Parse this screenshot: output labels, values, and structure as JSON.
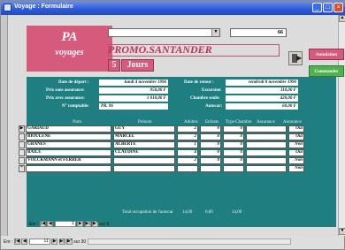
{
  "window": {
    "title": "Voyage : Formulaire"
  },
  "logo": {
    "line1": "PA",
    "line2": "voyages"
  },
  "header": {
    "combo_value": "",
    "trip_id": "66",
    "trip_name": "PROMO.SANTANDER",
    "duration_value": "5",
    "duration_unit": "Jours"
  },
  "buttons": {
    "annulation": "Annulation",
    "commander": "Commander"
  },
  "info": {
    "date_depart_label": "Date de départ :",
    "date_depart_value": "lundi 4 novembre 1996",
    "date_retour_label": "Date de retour :",
    "date_retour_value": "vendredi 8 novembre 1996",
    "prix_sans_label": "Prix sans assurance:",
    "prix_sans_value": "950,00 F",
    "excursion_label": "Excursion",
    "excursion_value": "110,00 F",
    "prix_avec_label": "Prix avec assurance:",
    "prix_avec_value": "1 010,00 F",
    "chambre_label": "Chambre seule:",
    "chambre_value": "420,00 F",
    "compta_label": "N° comptable:",
    "compta_value": "PR. 96",
    "autocar_label": "Autocar:",
    "autocar_value": "60,00 F"
  },
  "grid": {
    "headers": [
      "Nom",
      "Prénom",
      "Adultes",
      "Enfants",
      "Type Chambre",
      "Assurance",
      "Assurance"
    ],
    "rows": [
      {
        "nom": "GARIAUD",
        "prenom": "GUY",
        "adultes": "2",
        "enfants": "0",
        "chambre": "0",
        "assurance": "Oui"
      },
      {
        "nom": "BIOULENE",
        "prenom": "MARCEL",
        "adultes": "2",
        "enfants": "0",
        "chambre": "0",
        "assurance": "Oui"
      },
      {
        "nom": "GRANES",
        "prenom": "ALBERTE",
        "adultes": "1",
        "enfants": "0",
        "chambre": "0",
        "assurance": "Non"
      },
      {
        "nom": "BAILE",
        "prenom": "CLAUDINE",
        "adultes": "4",
        "enfants": "0",
        "chambre": "0",
        "assurance": "Oui"
      },
      {
        "nom": "VOLCKMANN et FERRER",
        "prenom": "",
        "adultes": "2",
        "enfants": "0",
        "chambre": "0",
        "assurance": "Non"
      },
      {
        "nom": "",
        "prenom": "",
        "adultes": "",
        "enfants": "",
        "chambre": "",
        "assurance": "Non"
      }
    ],
    "footer_label": "Total occupation de l'autocar",
    "footer_adultes": "14,00",
    "footer_enfants": "0,00",
    "footer_chambre": "14,00"
  },
  "subnav": {
    "label": "Enr :",
    "current": "1",
    "total_text": "sur 5"
  },
  "mainnav": {
    "label": "Enr :",
    "current": "11",
    "total_text": "sur 30"
  }
}
